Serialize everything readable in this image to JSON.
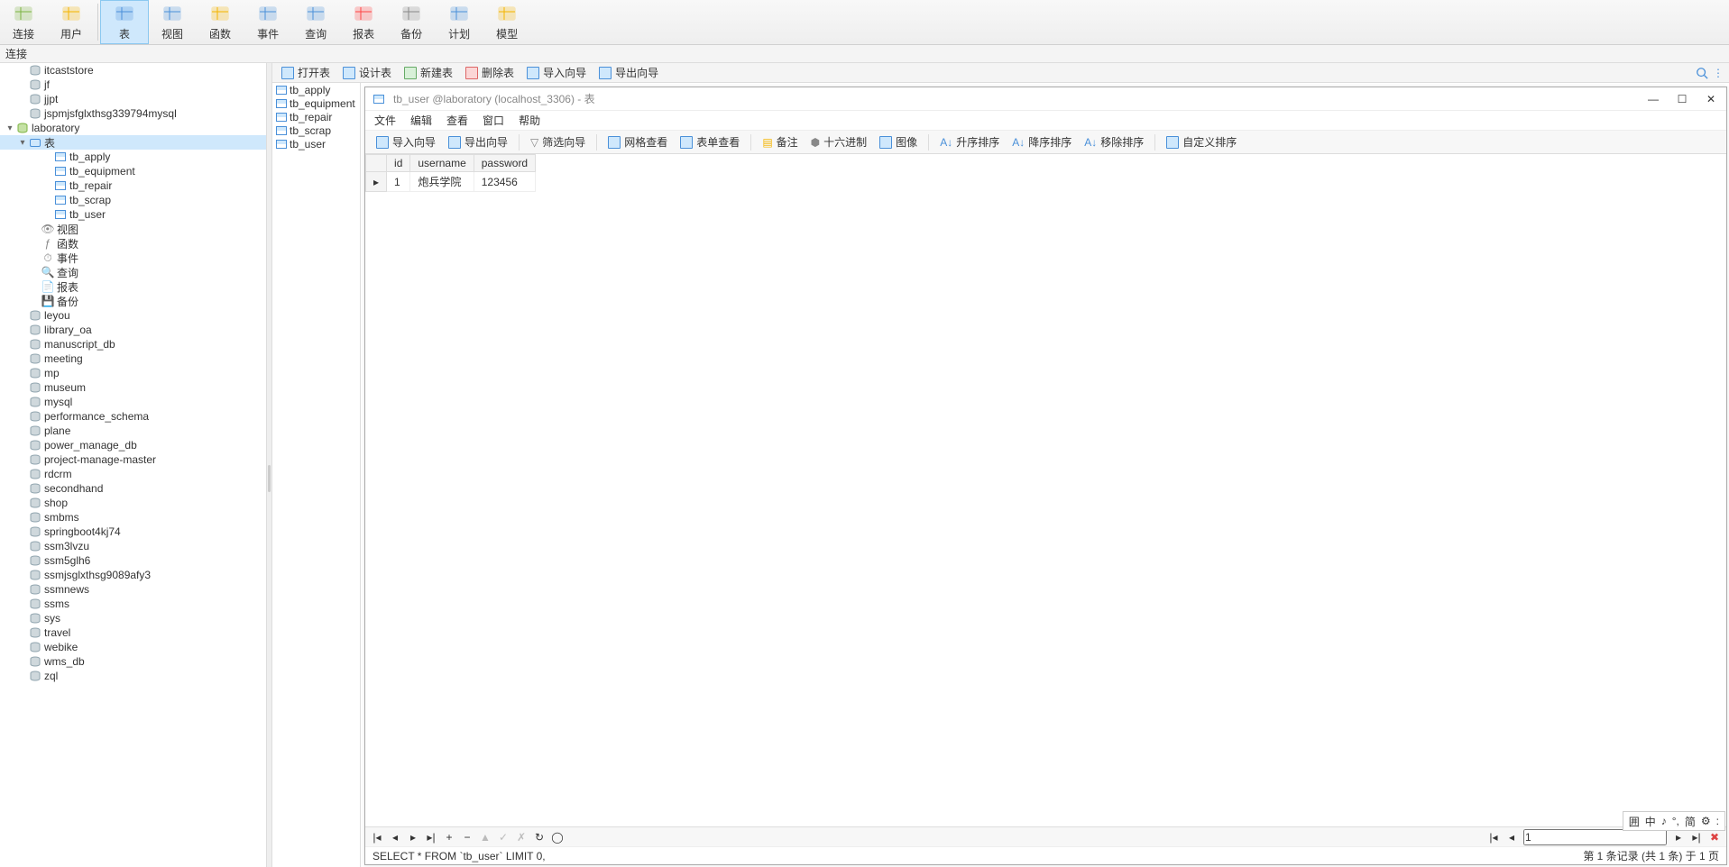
{
  "ribbon": [
    {
      "label": "连接",
      "icon": "plug",
      "color": "#7cb342"
    },
    {
      "label": "用户",
      "icon": "user",
      "color": "#f4b400"
    },
    {
      "label": "表",
      "icon": "table",
      "color": "#4a90d9",
      "active": true
    },
    {
      "label": "视图",
      "icon": "view",
      "color": "#4a90d9"
    },
    {
      "label": "函数",
      "icon": "fx",
      "color": "#f4b400"
    },
    {
      "label": "事件",
      "icon": "clock",
      "color": "#4a90d9"
    },
    {
      "label": "查询",
      "icon": "query",
      "color": "#4a90d9"
    },
    {
      "label": "报表",
      "icon": "report",
      "color": "#f44"
    },
    {
      "label": "备份",
      "icon": "backup",
      "color": "#888"
    },
    {
      "label": "计划",
      "icon": "plan",
      "color": "#4a90d9"
    },
    {
      "label": "模型",
      "icon": "model",
      "color": "#f4b400"
    }
  ],
  "conn_label": "连接",
  "toolbar": {
    "open": "打开表",
    "design": "设计表",
    "new": "新建表",
    "delete": "删除表",
    "import": "导入向导",
    "export": "导出向导"
  },
  "tree": {
    "dbs_before": [
      "itcaststore",
      "jf",
      "jjpt",
      "jspmjsfglxthsg339794mysql"
    ],
    "open_db": "laboratory",
    "open_group": "表",
    "tables": [
      "tb_apply",
      "tb_equipment",
      "tb_repair",
      "tb_scrap",
      "tb_user"
    ],
    "subgroups": [
      "视图",
      "函数",
      "事件",
      "查询",
      "报表",
      "备份"
    ],
    "dbs_after": [
      "leyou",
      "library_oa",
      "manuscript_db",
      "meeting",
      "mp",
      "museum",
      "mysql",
      "performance_schema",
      "plane",
      "power_manage_db",
      "project-manage-master",
      "rdcrm",
      "secondhand",
      "shop",
      "smbms",
      "springboot4kj74",
      "ssm3lvzu",
      "ssm5glh6",
      "ssmjsglxthsg9089afy3",
      "ssmnews",
      "ssms",
      "sys",
      "travel",
      "webike",
      "wms_db",
      "zql"
    ]
  },
  "obj_list": [
    "tb_apply",
    "tb_equipment",
    "tb_repair",
    "tb_scrap",
    "tb_user"
  ],
  "window": {
    "title": "tb_user @laboratory (localhost_3306) - 表",
    "menu": [
      "文件",
      "编辑",
      "查看",
      "窗口",
      "帮助"
    ],
    "toolbar": [
      "导入向导",
      "导出向导",
      "筛选向导",
      "网格查看",
      "表单查看",
      "备注",
      "十六进制",
      "图像",
      "升序排序",
      "降序排序",
      "移除排序",
      "自定义排序"
    ],
    "columns": [
      "id",
      "username",
      "password"
    ],
    "rows": [
      {
        "id": "1",
        "username": "炮兵学院",
        "password": "123456"
      }
    ],
    "sql": "SELECT * FROM `tb_user` LIMIT 0,",
    "status": "第 1 条记录 (共 1 条) 于 1 页",
    "page": "1"
  },
  "ime": [
    "囲",
    "中",
    "♪",
    "°,",
    "简",
    "⚙",
    ":"
  ]
}
